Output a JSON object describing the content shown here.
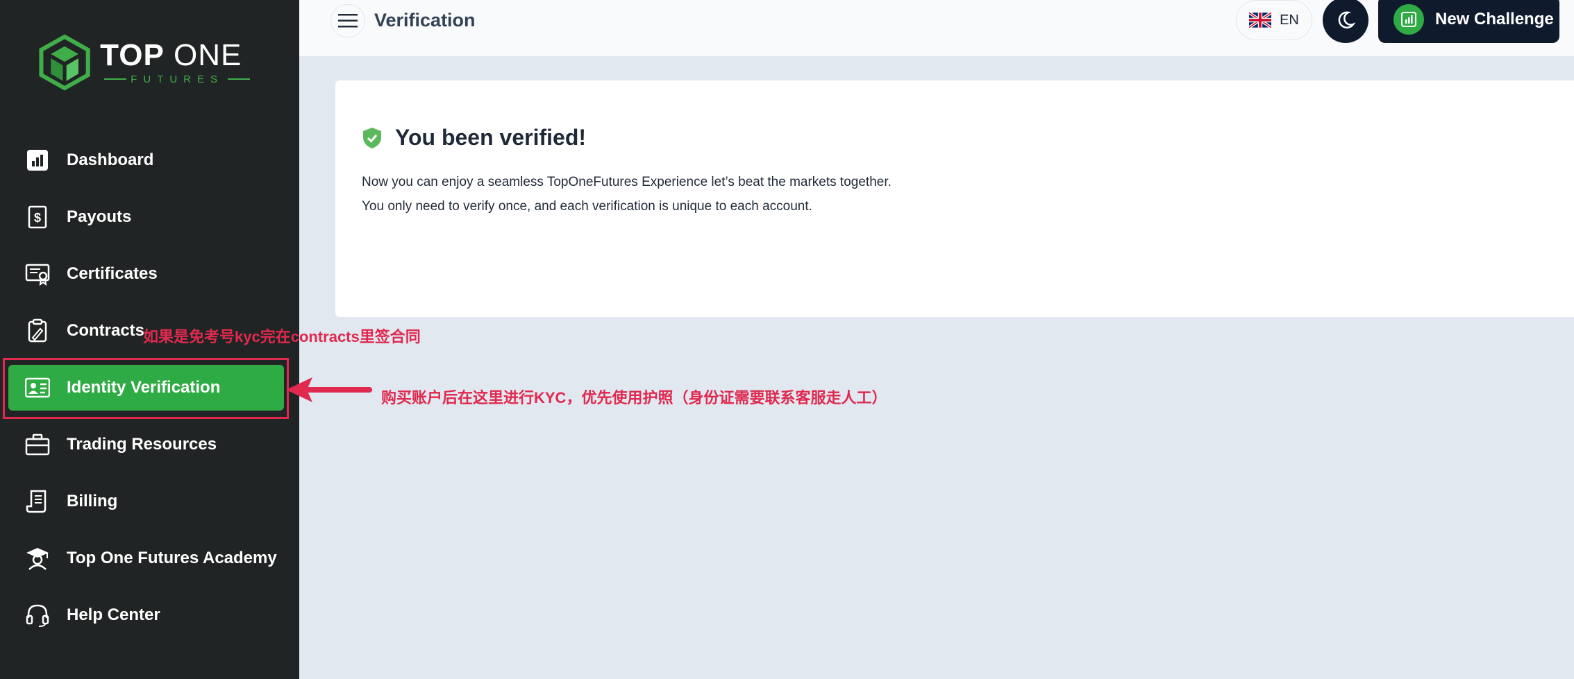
{
  "brand": {
    "top": "TOP",
    "one": "ONE",
    "sub": "FUTURES"
  },
  "sidebar": {
    "items": [
      {
        "label": "Dashboard",
        "icon": "dashboard-icon"
      },
      {
        "label": "Payouts",
        "icon": "payout-icon"
      },
      {
        "label": "Certificates",
        "icon": "certificate-icon"
      },
      {
        "label": "Contracts",
        "icon": "contract-icon"
      },
      {
        "label": "Identity Verification",
        "icon": "id-card-icon",
        "active": true
      },
      {
        "label": "Trading Resources",
        "icon": "briefcase-icon"
      },
      {
        "label": "Billing",
        "icon": "receipt-icon"
      },
      {
        "label": "Top One Futures Academy",
        "icon": "graduation-icon"
      },
      {
        "label": "Help Center",
        "icon": "headset-icon"
      }
    ]
  },
  "header": {
    "title": "Verification",
    "language": "EN",
    "new_challenge": "New Challenge"
  },
  "card": {
    "title": "You been verified!",
    "line1": "Now you can enjoy a seamless TopOneFutures Experience let’s beat the markets together.",
    "line2": "You only need to verify once, and each verification is unique to each account."
  },
  "annotations": {
    "contracts_note": "如果是免考号kyc完在contracts里签合同",
    "kyc_note": "购买账户后在这里进行KYC，优先使用护照（身份证需要联系客服走人工）"
  },
  "colors": {
    "accent": "#2fab46",
    "sidebar": "#212424",
    "annotation": "#e0294f",
    "dark_button": "#0f1b2d"
  }
}
